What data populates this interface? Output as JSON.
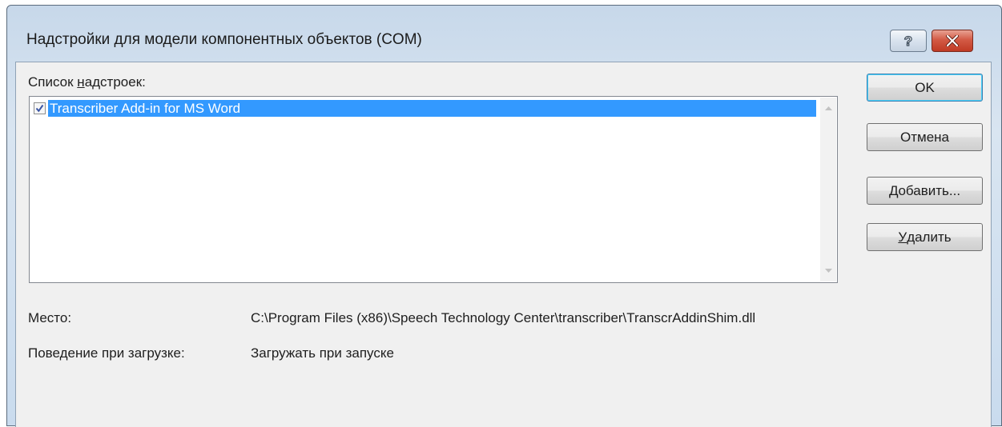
{
  "window": {
    "title": "Надстройки для модели компонентных объектов (COM)",
    "help_icon": "question-icon",
    "close_icon": "close-icon"
  },
  "addins": {
    "label_before": "Список ",
    "label_accel": "н",
    "label_after": "адстроек:",
    "items": [
      {
        "name": "Transcriber Add-in for MS Word",
        "checked": true,
        "selected": true
      }
    ]
  },
  "buttons": {
    "ok": "OK",
    "cancel": "Отмена",
    "add_accel": "Д",
    "add_rest": "обавить...",
    "remove_accel": "У",
    "remove_rest": "далить"
  },
  "details": {
    "location_label": "Место:",
    "location_value": "C:\\Program Files (x86)\\Speech Technology Center\\transcriber\\TranscrAddinShim.dll",
    "load_behavior_label": "Поведение при загрузке:",
    "load_behavior_value": "Загружать при запуске"
  },
  "colors": {
    "selection": "#3399ff",
    "dialog_bg": "#f0f0f0",
    "close_button": "#c8442e"
  }
}
